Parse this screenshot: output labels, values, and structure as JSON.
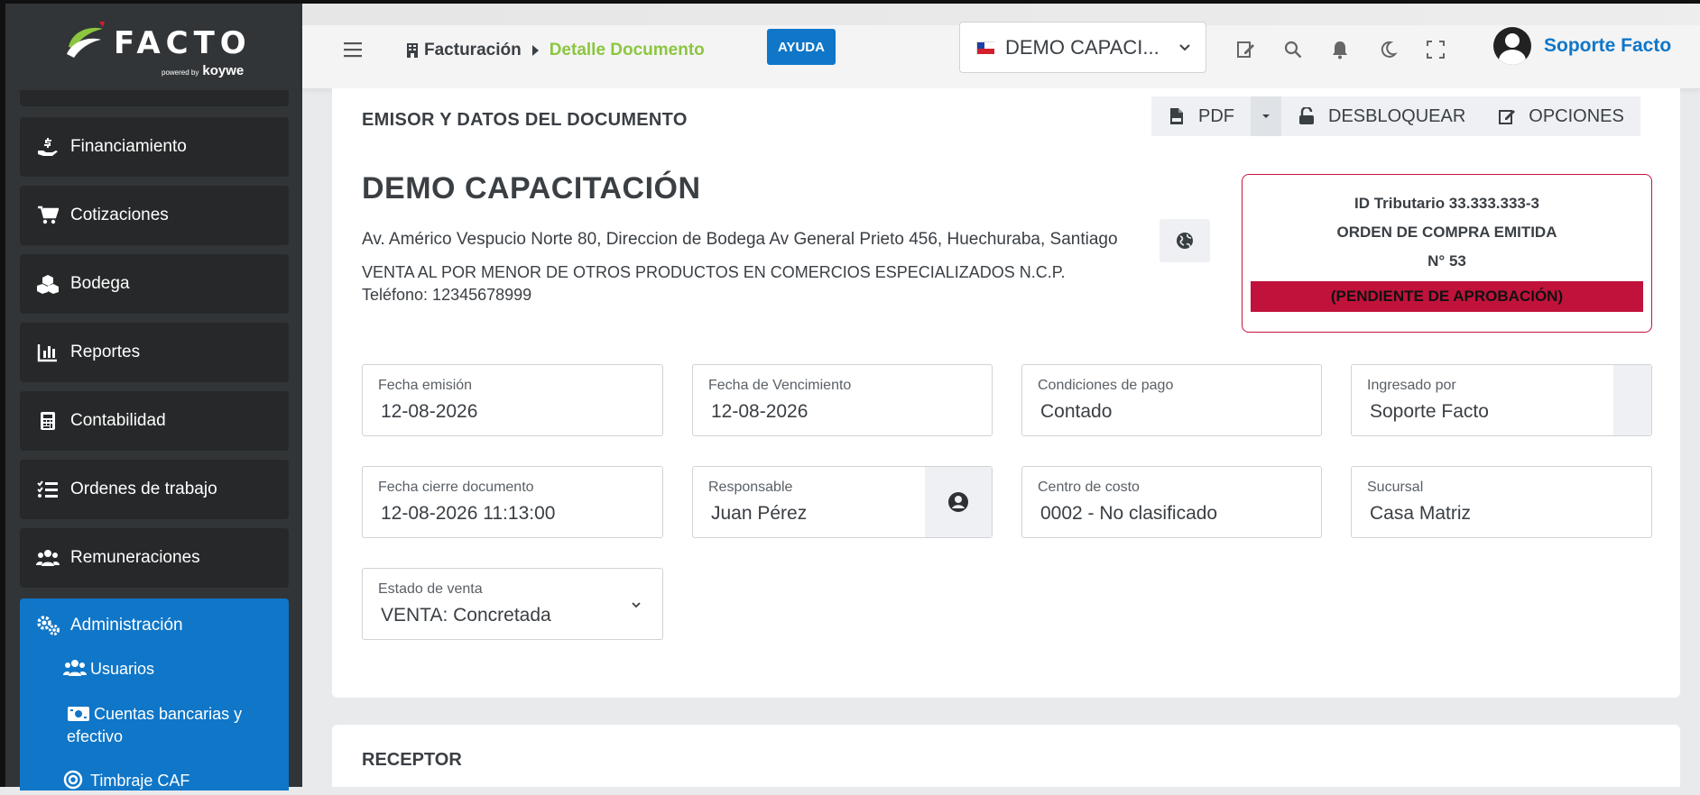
{
  "app": {
    "logo_text": "FACTO",
    "logo_powered": "powered by",
    "logo_brand": "koywe"
  },
  "sidebar": {
    "items": [
      {
        "label": "Financiamiento",
        "icon": "hand-dollar-icon"
      },
      {
        "label": "Cotizaciones",
        "icon": "cart-icon"
      },
      {
        "label": "Bodega",
        "icon": "boxes-icon"
      },
      {
        "label": "Reportes",
        "icon": "chart-bar-icon"
      },
      {
        "label": "Contabilidad",
        "icon": "calculator-icon"
      },
      {
        "label": "Ordenes de trabajo",
        "icon": "tasks-list-icon"
      },
      {
        "label": "Remuneraciones",
        "icon": "users-icon"
      }
    ],
    "active": {
      "label": "Administración",
      "icon": "gears-icon",
      "subitems": [
        {
          "label": "Usuarios",
          "icon": "users-icon"
        },
        {
          "label": "Cuentas bancarias y efectivo",
          "icon": "money-bill-icon"
        },
        {
          "label": "Timbraje CAF",
          "icon": "stamp-icon"
        }
      ]
    }
  },
  "header": {
    "breadcrumb_root": "Facturación",
    "breadcrumb_current": "Detalle Documento",
    "help_label": "AYUDA",
    "company_selector": "DEMO CAPACI...",
    "user_name": "Soporte Facto"
  },
  "emisor": {
    "section_title": "EMISOR Y DATOS DEL DOCUMENTO",
    "actions": {
      "pdf": "PDF",
      "unlock": "DESBLOQUEAR",
      "options": "OPCIONES"
    },
    "company_name": "DEMO CAPACITACIÓN",
    "address": "Av. Américo Vespucio Norte 80, Direccion de Bodega Av General Prieto 456, Huechuraba, Santiago",
    "activity": "VENTA AL POR MENOR DE OTROS PRODUCTOS EN COMERCIOS ESPECIALIZADOS N.C.P.",
    "phone": "Teléfono: 12345678999",
    "doc_box": {
      "tax_id": "ID Tributario 33.333.333-3",
      "doc_type": "ORDEN DE COMPRA EMITIDA",
      "number": "N° 53",
      "status": "(PENDIENTE DE APROBACIÓN)"
    },
    "fields": {
      "fecha_emision": {
        "label": "Fecha emisión",
        "value": "12-08-2026"
      },
      "fecha_vencimiento": {
        "label": "Fecha de Vencimiento",
        "value": "12-08-2026"
      },
      "condiciones_pago": {
        "label": "Condiciones de pago",
        "value": "Contado"
      },
      "ingresado_por": {
        "label": "Ingresado por",
        "value": "Soporte Facto"
      },
      "fecha_cierre": {
        "label": "Fecha cierre documento",
        "value": "12-08-2026 11:13:00"
      },
      "responsable": {
        "label": "Responsable",
        "value": "Juan Pérez"
      },
      "centro_costo": {
        "label": "Centro de costo",
        "value": "0002 - No clasificado"
      },
      "sucursal": {
        "label": "Sucursal",
        "value": "Casa Matriz"
      },
      "estado_venta": {
        "label": "Estado de venta",
        "value": "VENTA: Concretada"
      }
    }
  },
  "receptor": {
    "section_title": "RECEPTOR"
  },
  "colors": {
    "primary": "#0f76c8",
    "accent_green": "#8cc63f",
    "danger": "#c0123a",
    "sidebar_bg": "#323537"
  }
}
